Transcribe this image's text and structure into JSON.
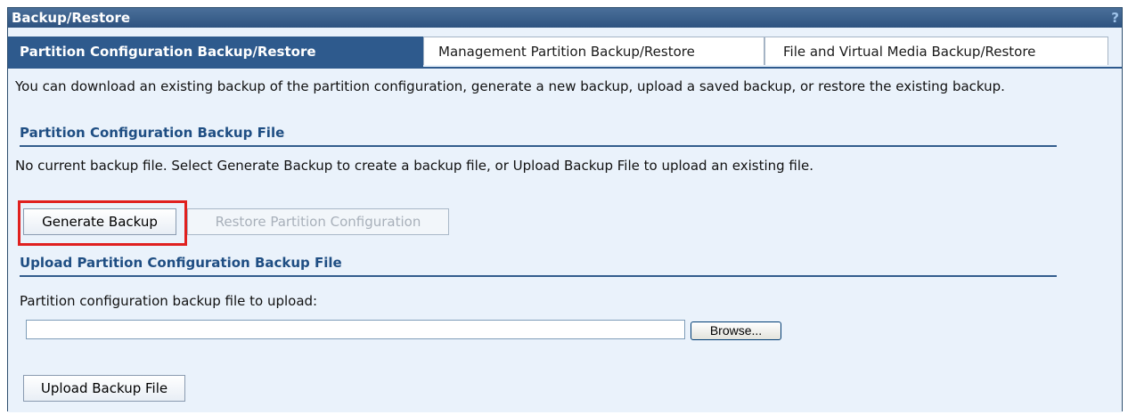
{
  "window": {
    "title": "Backup/Restore",
    "help_glyph": "?"
  },
  "tabs": [
    {
      "label": "Partition Configuration Backup/Restore",
      "active": true
    },
    {
      "label": "Management Partition Backup/Restore",
      "active": false
    },
    {
      "label": "File and Virtual Media Backup/Restore",
      "active": false
    }
  ],
  "intro_text": "You can download an existing backup of the partition configuration, generate a new backup, upload a saved backup, or restore the existing backup.",
  "backup_section": {
    "title": "Partition Configuration Backup File",
    "status_text": "No current backup file. Select Generate Backup to create a backup file, or Upload Backup File to upload an existing file.",
    "generate_label": "Generate Backup",
    "restore_label": "Restore Partition Configuration"
  },
  "upload_section": {
    "title": "Upload Partition Configuration Backup File",
    "field_label": "Partition configuration backup file to upload:",
    "file_value": "",
    "browse_label": "Browse...",
    "upload_label": "Upload Backup File"
  },
  "colors": {
    "accent": "#2e5a8d",
    "highlight": "#e0201f",
    "background": "#eaf2fb"
  }
}
